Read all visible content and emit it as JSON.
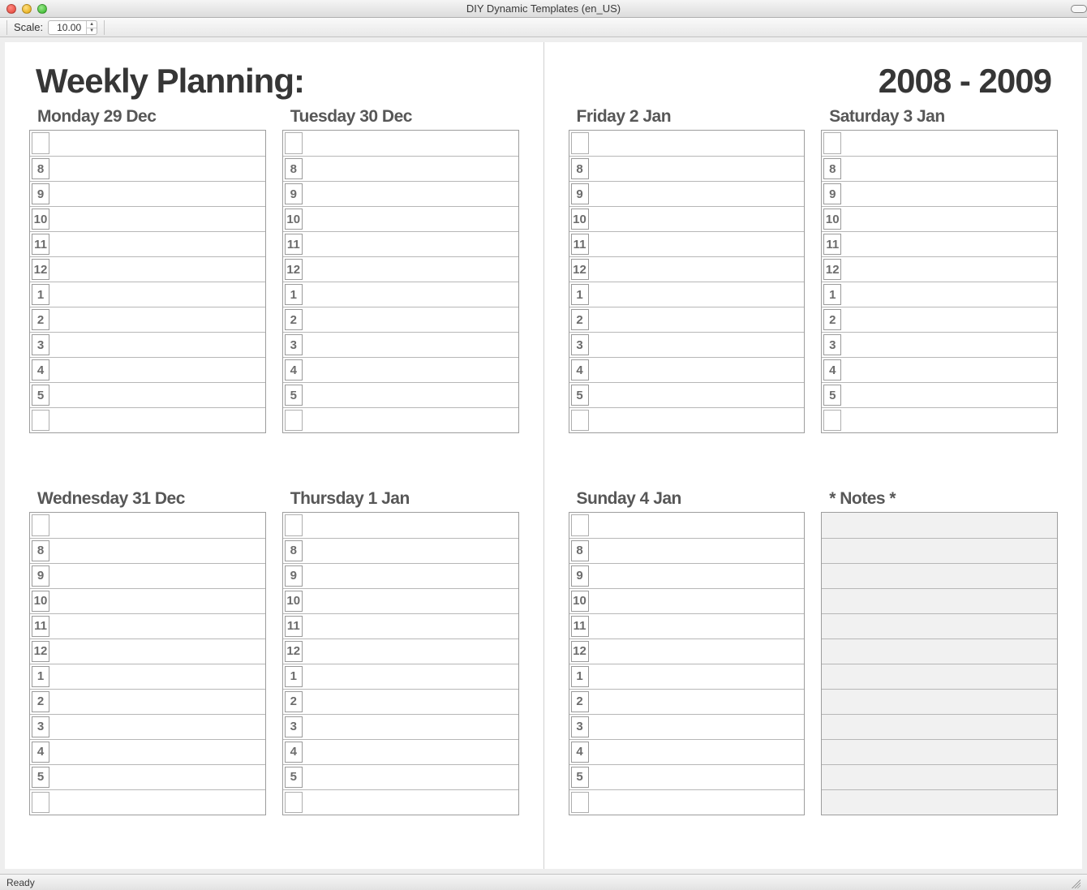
{
  "window": {
    "title": "DIY Dynamic Templates (en_US)"
  },
  "toolbar": {
    "scale_label": "Scale:",
    "scale_value": "10.00"
  },
  "planner": {
    "heading_left": "Weekly Planning:",
    "heading_right": "2008 - 2009",
    "hour_labels": [
      "",
      "8",
      "9",
      "10",
      "11",
      "12",
      "1",
      "2",
      "3",
      "4",
      "5",
      ""
    ],
    "days_left": [
      {
        "title": "Monday 29 Dec"
      },
      {
        "title": "Tuesday 30 Dec"
      },
      {
        "title": "Wednesday 31 Dec"
      },
      {
        "title": "Thursday 1 Jan"
      }
    ],
    "days_right": [
      {
        "title": "Friday 2 Jan"
      },
      {
        "title": "Saturday 3 Jan"
      },
      {
        "title": "Sunday 4 Jan"
      }
    ],
    "notes_title": "* Notes *",
    "notes_rows": 12
  },
  "status": {
    "text": "Ready"
  }
}
